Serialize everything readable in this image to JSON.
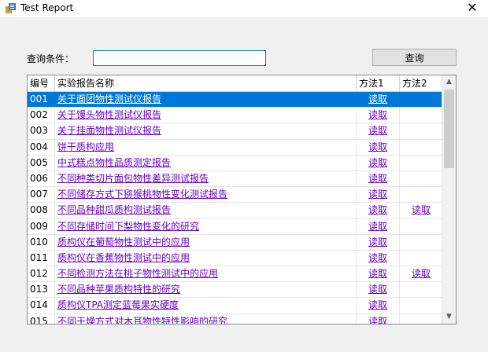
{
  "window": {
    "title": "Test Report",
    "close_glyph": "✕",
    "icon": "report-app-icon"
  },
  "query": {
    "label": "查询条件：",
    "value": "",
    "button_label": "查询"
  },
  "grid": {
    "columns": [
      "编号",
      "实验报告名称",
      "方法1",
      "方法2"
    ],
    "selected_row": 0,
    "rows": [
      {
        "id": "001",
        "name": "关于面团物性测试仪报告",
        "m1": "读取",
        "m2": ""
      },
      {
        "id": "002",
        "name": "关于馒头物性测试仪报告",
        "m1": "读取",
        "m2": ""
      },
      {
        "id": "003",
        "name": "关于挂面物性测试仪报告",
        "m1": "读取",
        "m2": ""
      },
      {
        "id": "004",
        "name": "饼干质构应用",
        "m1": "读取",
        "m2": ""
      },
      {
        "id": "005",
        "name": "中式糕点物性品质测定报告",
        "m1": "读取",
        "m2": ""
      },
      {
        "id": "006",
        "name": "不同种类切片面包物性差异测试报告",
        "m1": "读取",
        "m2": ""
      },
      {
        "id": "007",
        "name": "不同储存方式下猕猴桃物性变化测试报告",
        "m1": "读取",
        "m2": ""
      },
      {
        "id": "008",
        "name": "不同品种甜瓜质构测试报告",
        "m1": "读取",
        "m2": "读取"
      },
      {
        "id": "009",
        "name": "不同存储时间下梨物性变化的研究",
        "m1": "读取",
        "m2": ""
      },
      {
        "id": "010",
        "name": "质构仪在葡萄物性测试中的应用",
        "m1": "读取",
        "m2": ""
      },
      {
        "id": "011",
        "name": "质构仪在香蕉物性测试中的应用",
        "m1": "读取",
        "m2": ""
      },
      {
        "id": "012",
        "name": "不同检测方法在桃子物性测试中的应用",
        "m1": "读取",
        "m2": "读取"
      },
      {
        "id": "013",
        "name": "不同品种苹果质构特性的研究",
        "m1": "读取",
        "m2": ""
      },
      {
        "id": "014",
        "name": "质构仪TPA测定蓝莓果实硬度",
        "m1": "读取",
        "m2": ""
      },
      {
        "id": "015",
        "name": "不同干燥方式对木耳物性特性影响的研究",
        "m1": "读取",
        "m2": ""
      }
    ]
  },
  "scrollbar": {
    "up_icon": "▲",
    "down_icon": "▼"
  }
}
